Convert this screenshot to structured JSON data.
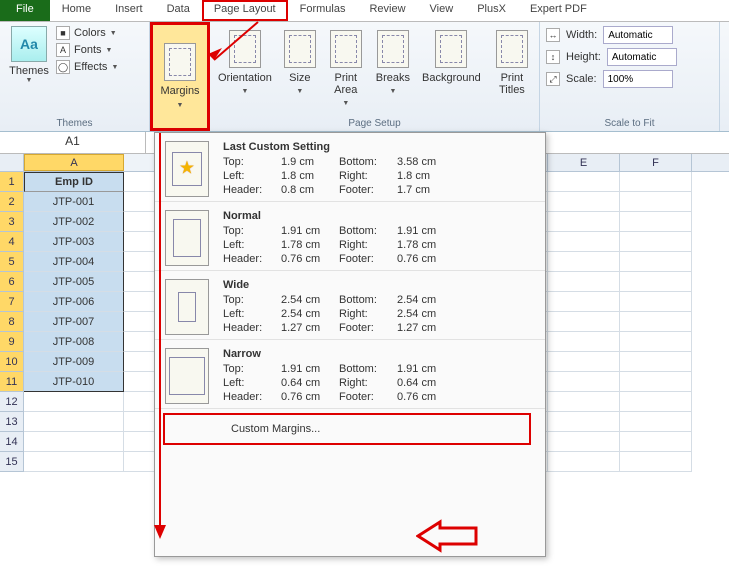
{
  "tabs": {
    "file": "File",
    "home": "Home",
    "insert": "Insert",
    "data": "Data",
    "pagelayout": "Page Layout",
    "formulas": "Formulas",
    "review": "Review",
    "view": "View",
    "plusx": "PlusX",
    "expertpdf": "Expert PDF"
  },
  "ribbon": {
    "themes": {
      "label": "Themes",
      "btn": "Themes",
      "colors": "Colors",
      "fonts": "Fonts",
      "effects": "Effects"
    },
    "pagesetup": {
      "label": "Page Setup",
      "margins": "Margins",
      "orientation": "Orientation",
      "size": "Size",
      "printarea": "Print Area",
      "breaks": "Breaks",
      "background": "Background",
      "printtitles": "Print Titles"
    },
    "scale": {
      "label": "Scale to Fit",
      "width": "Width:",
      "height": "Height:",
      "scale": "Scale:",
      "auto": "Automatic",
      "pct": "100%"
    }
  },
  "namebox": "A1",
  "columns": {
    "A": "A",
    "E": "E",
    "F": "F"
  },
  "rows": {
    "header": "Emp ID",
    "r": [
      "JTP-001",
      "JTP-002",
      "JTP-003",
      "JTP-004",
      "JTP-005",
      "JTP-006",
      "JTP-007",
      "JTP-008",
      "JTP-009",
      "JTP-010"
    ]
  },
  "rownums": [
    "1",
    "2",
    "3",
    "4",
    "5",
    "6",
    "7",
    "8",
    "9",
    "10",
    "11",
    "12",
    "13",
    "14",
    "15"
  ],
  "dropdown": {
    "last": {
      "title": "Last Custom Setting",
      "top_l": "Top:",
      "top_v": "1.9 cm",
      "bottom_l": "Bottom:",
      "bottom_v": "3.58 cm",
      "left_l": "Left:",
      "left_v": "1.8 cm",
      "right_l": "Right:",
      "right_v": "1.8 cm",
      "header_l": "Header:",
      "header_v": "0.8 cm",
      "footer_l": "Footer:",
      "footer_v": "1.7 cm"
    },
    "normal": {
      "title": "Normal",
      "top_l": "Top:",
      "top_v": "1.91 cm",
      "bottom_l": "Bottom:",
      "bottom_v": "1.91 cm",
      "left_l": "Left:",
      "left_v": "1.78 cm",
      "right_l": "Right:",
      "right_v": "1.78 cm",
      "header_l": "Header:",
      "header_v": "0.76 cm",
      "footer_l": "Footer:",
      "footer_v": "0.76 cm"
    },
    "wide": {
      "title": "Wide",
      "top_l": "Top:",
      "top_v": "2.54 cm",
      "bottom_l": "Bottom:",
      "bottom_v": "2.54 cm",
      "left_l": "Left:",
      "left_v": "2.54 cm",
      "right_l": "Right:",
      "right_v": "2.54 cm",
      "header_l": "Header:",
      "header_v": "1.27 cm",
      "footer_l": "Footer:",
      "footer_v": "1.27 cm"
    },
    "narrow": {
      "title": "Narrow",
      "top_l": "Top:",
      "top_v": "1.91 cm",
      "bottom_l": "Bottom:",
      "bottom_v": "1.91 cm",
      "left_l": "Left:",
      "left_v": "0.64 cm",
      "right_l": "Right:",
      "right_v": "0.64 cm",
      "header_l": "Header:",
      "header_v": "0.76 cm",
      "footer_l": "Footer:",
      "footer_v": "0.76 cm"
    },
    "custom": "Custom Margins..."
  }
}
